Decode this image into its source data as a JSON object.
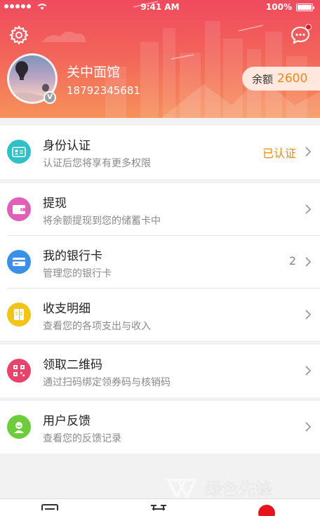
{
  "status_bar": {
    "time": "9:41 AM",
    "battery": "100%"
  },
  "header": {
    "bg_start": "#f04a5e",
    "bg_end": "#f6915a"
  },
  "user": {
    "name": "关中面馆",
    "phone": "18792345681",
    "badge": "V"
  },
  "balance": {
    "label": "余额",
    "value": "2600"
  },
  "groups": [
    {
      "items": [
        {
          "title": "身份认证",
          "subtitle": "认证后您将享有更多权限",
          "value": "已认证",
          "value_color": "#f08a10",
          "icon": "id-card-icon",
          "icon_color": "#2fc0c8"
        }
      ]
    },
    {
      "items": [
        {
          "title": "提现",
          "subtitle": "将余额提现到您的储蓄卡中",
          "icon": "wallet-icon",
          "icon_color": "#e25fb8"
        },
        {
          "title": "我的银行卡",
          "subtitle": "管理您的银行卡",
          "value": "2",
          "value_color": "#888888",
          "icon": "bank-card-icon",
          "icon_color": "#3a8fe8"
        },
        {
          "title": "收支明细",
          "subtitle": "查看您的各项支出与收入",
          "icon": "ledger-icon",
          "icon_color": "#f2c318"
        }
      ]
    },
    {
      "items": [
        {
          "title": "领取二维码",
          "subtitle": "通过扫码绑定领券码与核销码",
          "icon": "qr-code-icon",
          "icon_color": "#e8436a"
        }
      ]
    },
    {
      "items": [
        {
          "title": "用户反馈",
          "subtitle": "查看您的反馈记录",
          "icon": "feedback-icon",
          "icon_color": "#6ccc3a"
        }
      ]
    }
  ],
  "watermark": "绿色先锋"
}
